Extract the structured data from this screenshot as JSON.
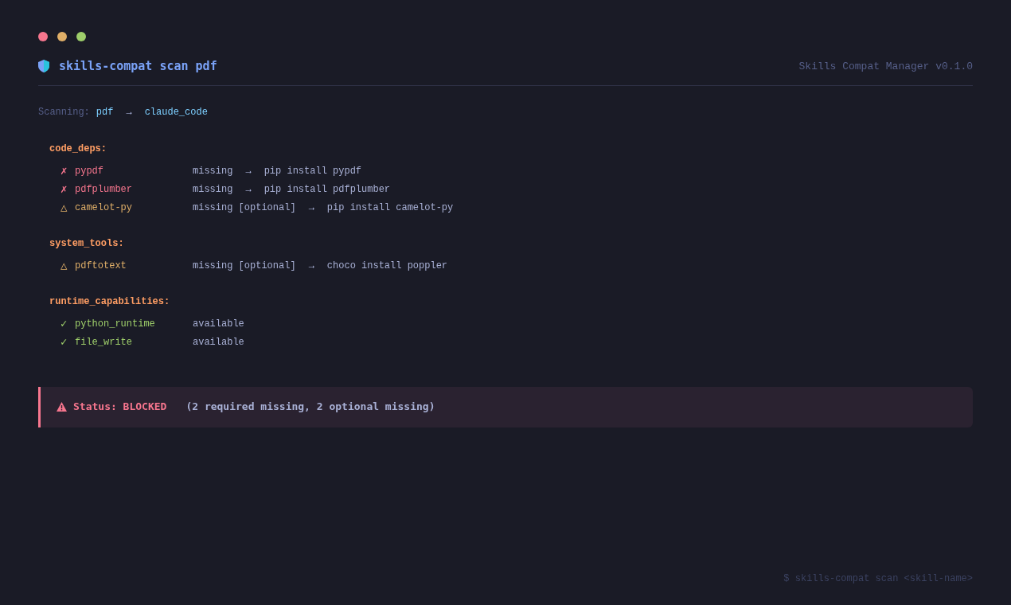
{
  "header": {
    "title": "skills-compat scan pdf",
    "app_version": "Skills Compat Manager v0.1.0"
  },
  "scanning": {
    "label": "Scanning:",
    "skill": "pdf",
    "arrow": "→",
    "target": "claude_code"
  },
  "sections": [
    {
      "title": "code_deps:",
      "items": [
        {
          "kind": "missing",
          "mark": "✗",
          "name": "pypdf",
          "status": "missing",
          "arrow": "→",
          "command": "pip install pypdf"
        },
        {
          "kind": "missing",
          "mark": "✗",
          "name": "pdfplumber",
          "status": "missing",
          "arrow": "→",
          "command": "pip install pdfplumber"
        },
        {
          "kind": "optional",
          "mark": "△",
          "name": "camelot-py",
          "status": "missing [optional]",
          "arrow": "→",
          "command": "pip install camelot-py"
        }
      ]
    },
    {
      "title": "system_tools:",
      "items": [
        {
          "kind": "optional",
          "mark": "△",
          "name": "pdftotext",
          "status": "missing [optional]",
          "arrow": "→",
          "command": "choco install poppler"
        }
      ]
    },
    {
      "title": "runtime_capabilities:",
      "items": [
        {
          "kind": "available",
          "mark": "✓",
          "name": "python_runtime",
          "status": "available"
        },
        {
          "kind": "available",
          "mark": "✓",
          "name": "file_write",
          "status": "available"
        }
      ]
    }
  ],
  "status": {
    "label": "Status: BLOCKED",
    "detail": "(2 required missing, 2 optional missing)"
  },
  "footer_hint": "$ skills-compat scan <skill-name>"
}
